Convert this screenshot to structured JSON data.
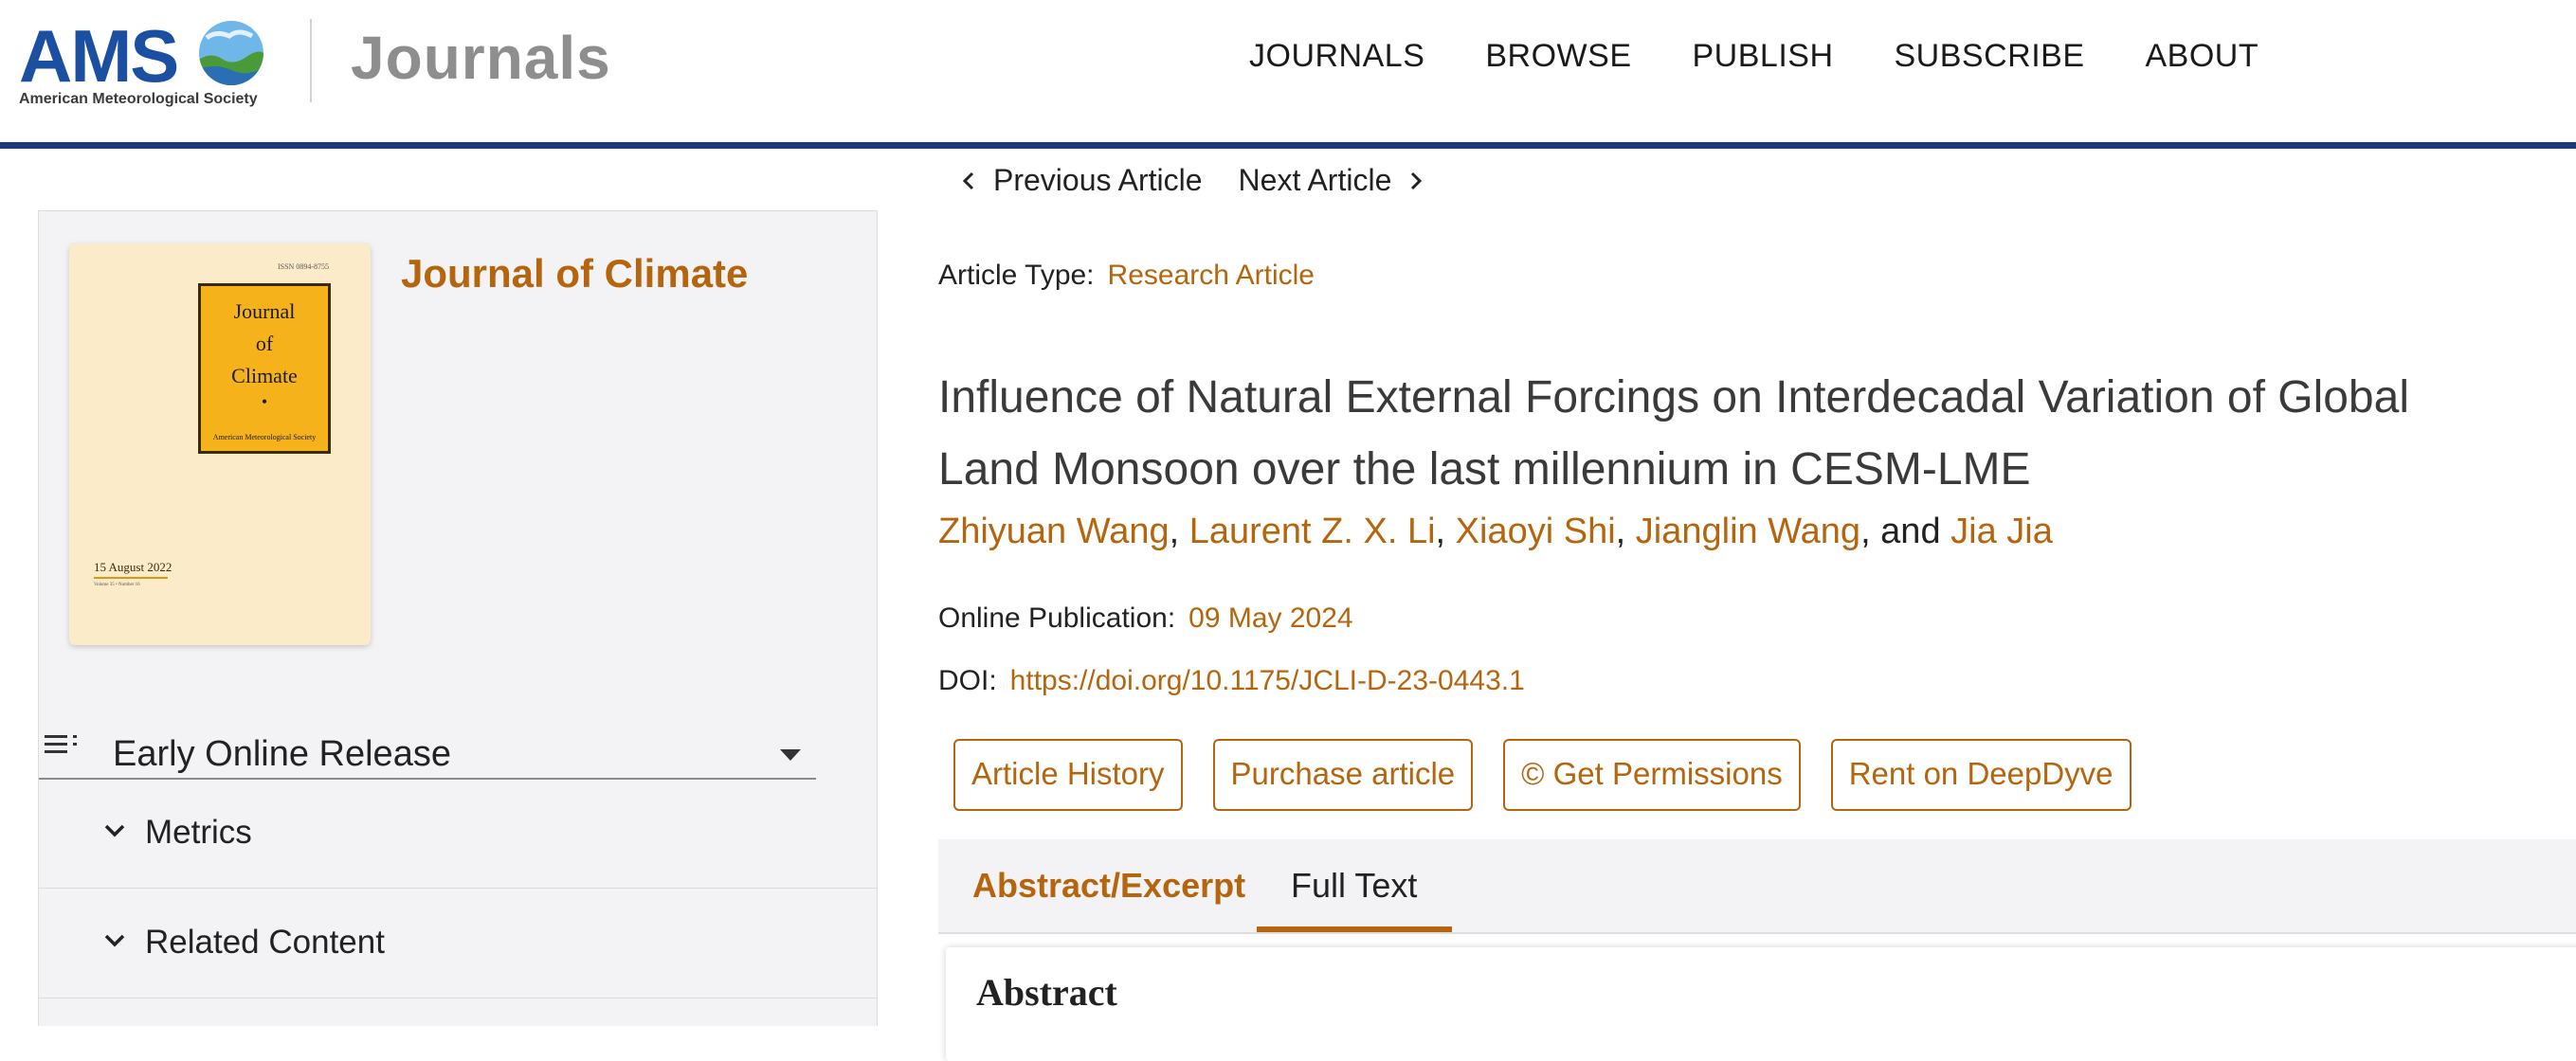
{
  "header": {
    "logo_text": "AMS",
    "society": "American Meteorological Society",
    "brand": "Journals",
    "nav": [
      "JOURNALS",
      "BROWSE",
      "PUBLISH",
      "SUBSCRIBE",
      "ABOUT"
    ]
  },
  "article_nav": {
    "previous": "Previous Article",
    "next": "Next Article"
  },
  "sidebar": {
    "journal_title": "Journal of Climate",
    "cover": {
      "issn": "ISSN 0894-8755",
      "title_lines": [
        "Journal",
        "of",
        "Climate"
      ],
      "dot": "•",
      "society": "American Meteorological Society",
      "date": "15 August 2022",
      "volume_line": "Volume 35 • Number 16"
    },
    "release_label": "Early Online Release",
    "accordion": [
      "Metrics",
      "Related Content"
    ]
  },
  "article": {
    "type_label": "Article Type:",
    "type_value": "Research Article",
    "title": "Influence of Natural External Forcings on Interdecadal Variation of Global Land Monsoon over the last millennium in CESM-LME",
    "authors": [
      "Zhiyuan Wang",
      "Laurent Z. X. Li",
      "Xiaoyi Shi",
      "Jianglin Wang",
      "Jia Jia"
    ],
    "authors_sep": ", ",
    "authors_and": ", and ",
    "pub_label": "Online Publication:",
    "pub_value": "09 May 2024",
    "doi_label": "DOI:",
    "doi_value": "https://doi.org/10.1175/JCLI-D-23-0443.1",
    "buttons": [
      "Article History",
      "Purchase article",
      "© Get Permissions",
      "Rent on DeepDyve"
    ]
  },
  "tabs": [
    "Abstract/Excerpt",
    "Full Text"
  ],
  "abstract_heading": "Abstract",
  "colors": {
    "accent": "#b5650d",
    "header_rule": "#1d3a78",
    "logo_blue": "#1b4fa2",
    "cover_bg": "#fcebc9",
    "cover_box": "#f5b21a"
  }
}
